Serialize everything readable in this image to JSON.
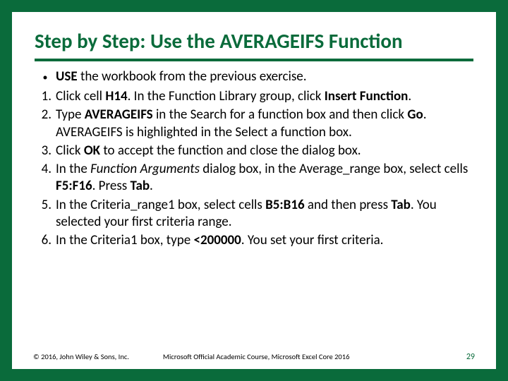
{
  "title": "Step by Step: Use the AVERAGEIFS Function",
  "bullet": {
    "pre_bold": "USE",
    "post": " the workbook from the previous exercise."
  },
  "steps": [
    {
      "n": "1.",
      "parts": [
        {
          "t": "Click cell "
        },
        {
          "t": "H14",
          "b": true
        },
        {
          "t": ". In the Function Library group, click "
        },
        {
          "t": "Insert Function",
          "b": true
        },
        {
          "t": "."
        }
      ]
    },
    {
      "n": "2.",
      "parts": [
        {
          "t": "Type "
        },
        {
          "t": "AVERAGEIFS",
          "b": true
        },
        {
          "t": " in the Search for a function box and then click "
        },
        {
          "t": "Go",
          "b": true
        },
        {
          "t": ". AVERAGEIFS is highlighted in the Select a function box."
        }
      ]
    },
    {
      "n": "3.",
      "parts": [
        {
          "t": "Click "
        },
        {
          "t": "OK",
          "b": true
        },
        {
          "t": " to accept the function and close the dialog box."
        }
      ]
    },
    {
      "n": "4.",
      "parts": [
        {
          "t": "In the "
        },
        {
          "t": "Function Arguments",
          "i": true
        },
        {
          "t": " dialog box, in the Average_range box, select cells "
        },
        {
          "t": "F5:F16",
          "b": true
        },
        {
          "t": ". Press "
        },
        {
          "t": "Tab",
          "b": true
        },
        {
          "t": "."
        }
      ]
    },
    {
      "n": "5.",
      "parts": [
        {
          "t": "In the Criteria_range1 box, select cells "
        },
        {
          "t": "B5:B16",
          "b": true
        },
        {
          "t": " and then press "
        },
        {
          "t": "Tab",
          "b": true
        },
        {
          "t": ". You selected your first criteria range."
        }
      ]
    },
    {
      "n": "6.",
      "parts": [
        {
          "t": "In the Criteria1 box, type "
        },
        {
          "t": "<200000",
          "b": true
        },
        {
          "t": ". You set your first criteria."
        }
      ]
    }
  ],
  "footer": {
    "copyright": "© 2016, John Wiley & Sons, Inc.",
    "course": "Microsoft Official Academic Course, Microsoft Excel Core 2016",
    "page": "29"
  }
}
